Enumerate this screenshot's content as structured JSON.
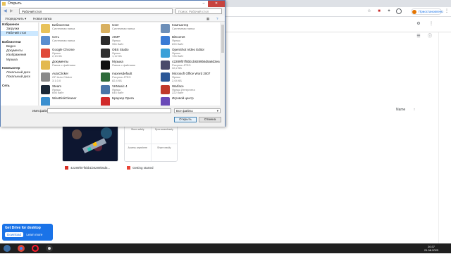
{
  "browser": {
    "profile_label": "Приостановлено",
    "toolbar_icons": [
      "star-icon",
      "shield-icon",
      "extension-icon",
      "profile-icon",
      "menu-icon"
    ]
  },
  "drive": {
    "sort_label": "Name",
    "sort_arrow": "↑",
    "files": [
      {
        "name": "42289f07f5bb1b8289b6d5...",
        "type": "image"
      },
      {
        "name": "Getting started",
        "type": "pdf"
      }
    ],
    "preview_texts": [
      "Store safely",
      "Sync seamlessly",
      "Access anywhere",
      "Share easily"
    ],
    "promo": {
      "title": "Get Drive for desktop",
      "download": "Download",
      "learn": "Learn more"
    }
  },
  "dialog": {
    "title": "Открыть",
    "path": "Рабочий стол",
    "search_placeholder": "Поиск: Рабочий стол",
    "organize": "Упорядочить ▾",
    "new_folder": "Новая папка",
    "nav": [
      {
        "label": "Избранное",
        "bold": true
      },
      {
        "label": "Загрузки"
      },
      {
        "label": "Рабочий стол",
        "selected": true
      },
      {
        "label": ""
      },
      {
        "label": "Библиотеки",
        "bold": true
      },
      {
        "label": "Видео"
      },
      {
        "label": "Документы"
      },
      {
        "label": "Изображения"
      },
      {
        "label": "Музыка"
      },
      {
        "label": ""
      },
      {
        "label": "Компьютер",
        "bold": true
      },
      {
        "label": "Локальный диск"
      },
      {
        "label": "Локальный диск"
      },
      {
        "label": ""
      },
      {
        "label": "Сеть",
        "bold": true
      }
    ],
    "items": [
      {
        "name": "Библиотеки",
        "l1": "Системная папка",
        "l2": "",
        "color": "#e8c25a"
      },
      {
        "name": "User",
        "l1": "Системная папка",
        "l2": "",
        "color": "#d8b060"
      },
      {
        "name": "Компьютер",
        "l1": "Системная папка",
        "l2": "",
        "color": "#6d8fb8"
      },
      {
        "name": "Сеть",
        "l1": "Системная папка",
        "l2": "",
        "color": "#5a8ed0"
      },
      {
        "name": "AIMP",
        "l1": "Ярлык",
        "l2": "956 байт",
        "color": "#2b2b2b"
      },
      {
        "name": "BitComet",
        "l1": "Ярлык",
        "l2": "890 байт",
        "color": "#3a7bd5"
      },
      {
        "name": "Google Chrome",
        "l1": "Ярлык",
        "l2": "2,13 КБ",
        "color": "#e04a3a"
      },
      {
        "name": "OBS Studio",
        "l1": "Ярлык",
        "l2": "1,12 КБ",
        "color": "#303030"
      },
      {
        "name": "OpenShot Video Editor",
        "l1": "Ярлык",
        "l2": "726 байт",
        "color": "#3aa0d8"
      },
      {
        "name": "Документы",
        "l1": "Папка с файлами",
        "l2": "",
        "color": "#e3b94f"
      },
      {
        "name": "Музыка",
        "l1": "Папка с файлами",
        "l2": "",
        "color": "#111111"
      },
      {
        "name": "42289f07f5bb1b8289b6d5a8d3eafe24",
        "l1": "Рисунок JPEG",
        "l2": "32,2 КБ",
        "color": "#4a4a6a"
      },
      {
        "name": "AutoClicker",
        "l1": "OP Auto Clicker",
        "l2": "3.1.0.0",
        "color": "#8a8a8a"
      },
      {
        "name": "maxresdefault",
        "l1": "Рисунок JPEG",
        "l2": "82,4 КБ",
        "color": "#2e6b3a"
      },
      {
        "name": "Microsoft Office Word 2007",
        "l1": "Ярлык",
        "l2": "2,04 КБ",
        "color": "#2b5797"
      },
      {
        "name": "Steam",
        "l1": "Ярлык",
        "l2": "698 байт",
        "color": "#1b2838"
      },
      {
        "name": "VKMusic 4",
        "l1": "Ярлык",
        "l2": "645 байт",
        "color": "#4a76a8"
      },
      {
        "name": "Warface",
        "l1": "Ярлык Интернета",
        "l2": "222 байт",
        "color": "#c0392b"
      },
      {
        "name": "WiseDiskCleaner",
        "l1": "",
        "l2": "",
        "color": "#3a8fd0"
      },
      {
        "name": "Браузер Opera",
        "l1": "",
        "l2": "",
        "color": "#d12a2a"
      },
      {
        "name": "Игровой центр",
        "l1": "",
        "l2": "",
        "color": "#6a4ab8"
      }
    ],
    "filename_label": "Имя файла:",
    "filter_value": "Все файлы",
    "open_label": "Открыть",
    "cancel_label": "Отмена"
  },
  "taskbar": {
    "time": "20:37",
    "date": "21.08.2023",
    "apps": [
      "windows-start-icon",
      "chrome-taskbar-icon",
      "opera-taskbar-icon",
      "obs-taskbar-icon"
    ]
  }
}
